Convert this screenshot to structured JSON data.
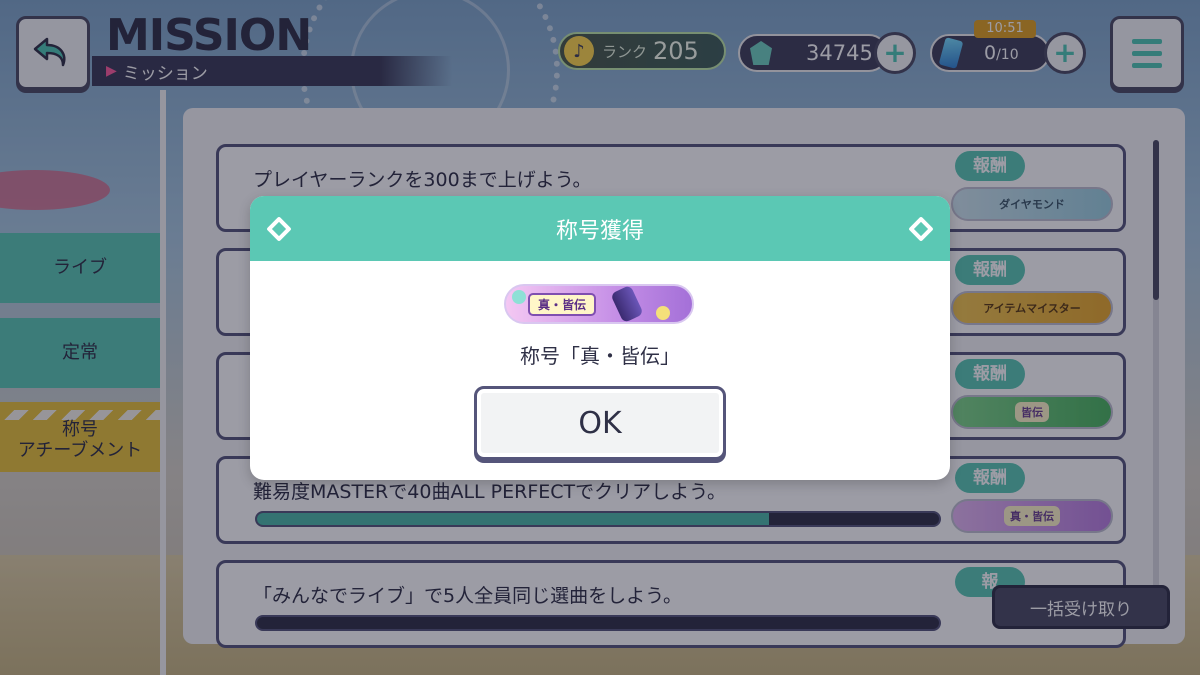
{
  "header": {
    "title": "MISSION",
    "subtitle": "ミッション",
    "rank_label": "ランク",
    "rank_value": "205",
    "gems": "34745",
    "stamina_timer": "10:51",
    "stamina_current": "0",
    "stamina_max": "/10"
  },
  "sidebar": {
    "items": [
      {
        "label": "ライブ"
      },
      {
        "label": "定常"
      },
      {
        "label": "称号\nアチーブメント"
      }
    ]
  },
  "missions": [
    {
      "text": "プレイヤーランクを300まで上げよう。",
      "reward_tag": "報酬",
      "reward": "ダイヤモンド",
      "progress": null
    },
    {
      "text": "",
      "reward_tag": "報酬",
      "reward": "アイテムマイスター",
      "progress": null
    },
    {
      "text": "",
      "reward_tag": "報酬",
      "reward": "皆伝",
      "progress": null
    },
    {
      "text": "難易度MASTERで40曲ALL PERFECTでクリアしよう。",
      "reward_tag": "報酬",
      "reward": "真・皆伝",
      "progress": 0.75
    },
    {
      "text": "「みんなでライブ」で5人全員同じ選曲をしよう。",
      "reward_tag": "報",
      "reward": "",
      "progress": 0.0
    }
  ],
  "bulk_receive": "一括受け取り",
  "modal": {
    "title": "称号獲得",
    "badge_text": "真・皆伝",
    "message": "称号「真・皆伝」",
    "ok": "OK"
  },
  "colors": {
    "accent": "#5bc8b4",
    "dark": "#4a4a62",
    "tab_active": "#e9c33a"
  }
}
